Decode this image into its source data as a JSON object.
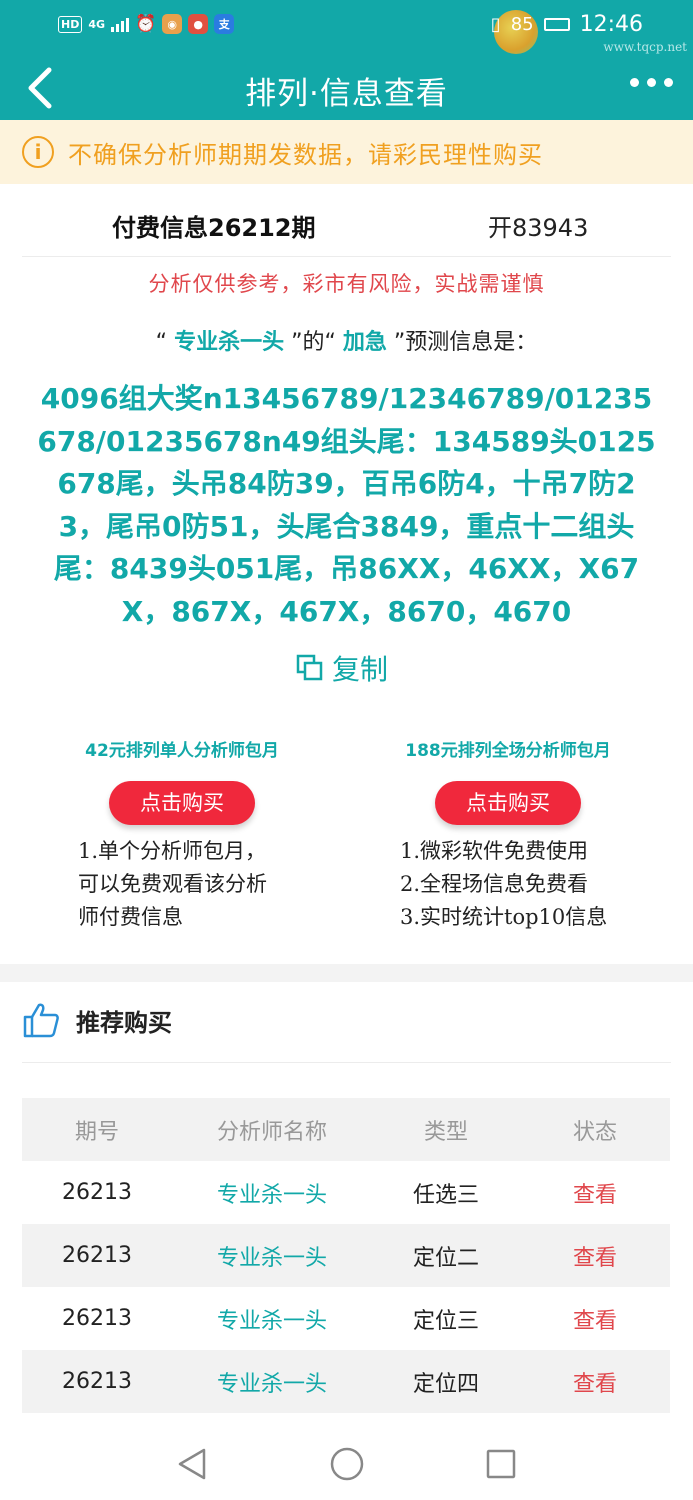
{
  "status_bar": {
    "hd": "HD",
    "network": "4G",
    "time": "12:46",
    "battery": "85",
    "watermark": "www.tqcp.net"
  },
  "header": {
    "title": "排列·信息查看"
  },
  "warning": {
    "text": "不确保分析师期期发数据，请彩民理性购买"
  },
  "info": {
    "title": "付费信息26212期",
    "open_number": "开83943",
    "disclaimer": "分析仅供参考，彩市有风险，实战需谨慎",
    "label_open_quote": "“",
    "analyst": "专业杀一头",
    "label_mid": "”的“",
    "mode": "加急",
    "label_tail": "”预测信息是：",
    "prediction": "4096组大奖n13456789/12346789/01235678/01235678n49组头尾：134589头0125678尾，头吊84防39，百吊6防4，十吊7防23，尾吊0防51，头尾合3849，重点十二组头尾：8439头051尾，吊86XX，46XX，X67X，867X，467X，8670，4670",
    "copy_label": "复制"
  },
  "packages": [
    {
      "title": "42元排列单人分析师包月",
      "button": "点击购买",
      "lines": [
        "1.单个分析师包月，",
        "可以免费观看该分析",
        "师付费信息"
      ]
    },
    {
      "title": "188元排列全场分析师包月",
      "button": "点击购买",
      "lines": [
        "1.微彩软件免费使用",
        "2.全程场信息免费看",
        "3.实时统计top10信息"
      ]
    }
  ],
  "recommend": {
    "title": "推荐购买",
    "columns": [
      "期号",
      "分析师名称",
      "类型",
      "状态"
    ],
    "rows": [
      {
        "period": "26213",
        "analyst": "专业杀一头",
        "type": "任选三",
        "status": "查看"
      },
      {
        "period": "26213",
        "analyst": "专业杀一头",
        "type": "定位二",
        "status": "查看"
      },
      {
        "period": "26213",
        "analyst": "专业杀一头",
        "type": "定位三",
        "status": "查看"
      },
      {
        "period": "26213",
        "analyst": "专业杀一头",
        "type": "定位四",
        "status": "查看"
      }
    ]
  },
  "colors": {
    "teal": "#12a8a8",
    "red": "#e0474c",
    "warning_bg": "#fdf3dc",
    "warning_fg": "#f0a020",
    "buy_button": "#f0283c"
  }
}
